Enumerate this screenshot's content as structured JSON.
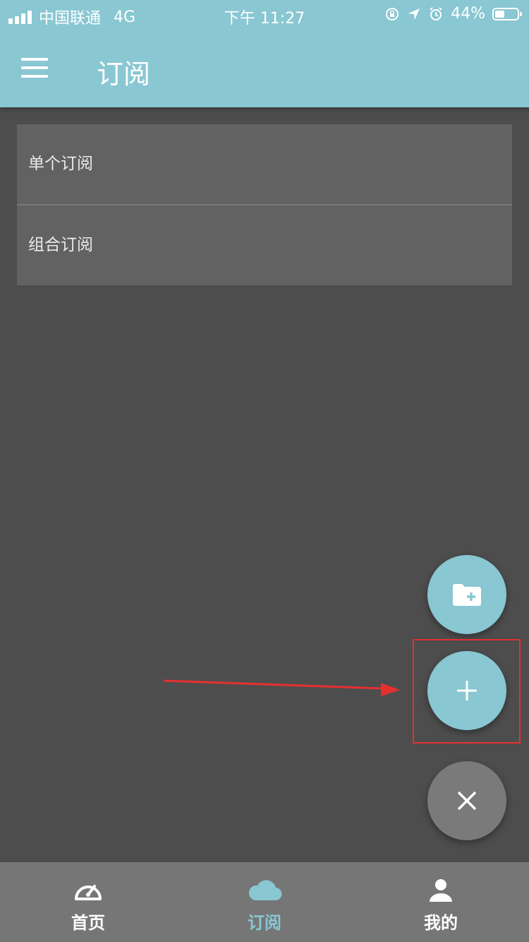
{
  "status_bar": {
    "carrier": "中国联通",
    "network": "4G",
    "time": "下午 11:27",
    "battery": "44%",
    "battery_level": 0.44,
    "icons": [
      "signal-icon",
      "orientation-lock-icon",
      "location-icon",
      "alarm-icon",
      "battery-icon"
    ]
  },
  "header": {
    "title": "订阅",
    "menu_icon": "hamburger-menu-icon"
  },
  "list": {
    "items": [
      {
        "label": "单个订阅"
      },
      {
        "label": "组合订阅"
      }
    ]
  },
  "fab": {
    "folder_icon": "folder-add-icon",
    "add_icon": "plus-icon",
    "close_icon": "close-icon"
  },
  "bottom_nav": {
    "items": [
      {
        "label": "首页",
        "icon": "speedometer-icon",
        "active": false
      },
      {
        "label": "订阅",
        "icon": "cloud-icon",
        "active": true
      },
      {
        "label": "我的",
        "icon": "user-icon",
        "active": false
      }
    ]
  },
  "colors": {
    "accent": "#89c7d2",
    "background": "#4d4d4d",
    "list_background": "#626262",
    "nav_background": "#767676",
    "annotation_red": "#e53030"
  }
}
